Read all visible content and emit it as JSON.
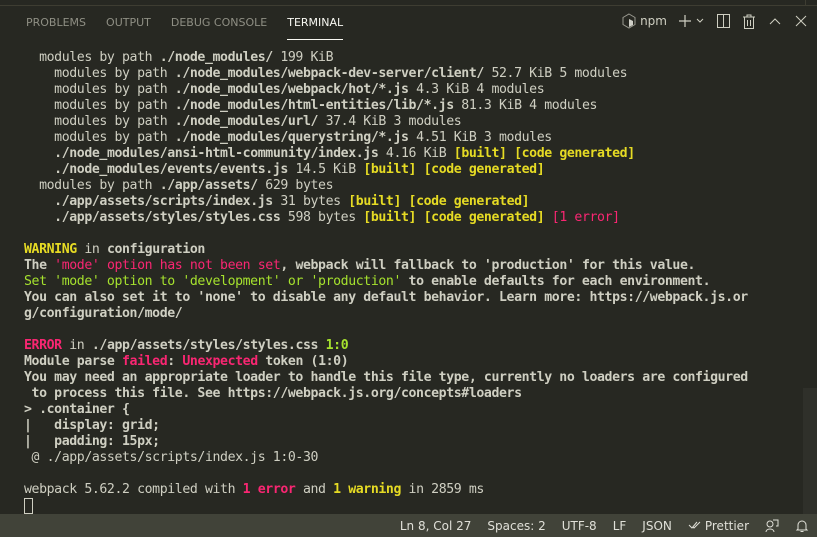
{
  "panel": {
    "tabs": [
      {
        "label": "PROBLEMS",
        "active": false
      },
      {
        "label": "OUTPUT",
        "active": false
      },
      {
        "label": "DEBUG CONSOLE",
        "active": false
      },
      {
        "label": "TERMINAL",
        "active": true
      }
    ],
    "terminal_name": "npm"
  },
  "terminal": {
    "lines": [
      [
        [
          "  modules by path ",
          ""
        ],
        [
          "./node_modules/",
          "b"
        ],
        [
          " 199 KiB",
          ""
        ]
      ],
      [
        [
          "    modules by path ",
          ""
        ],
        [
          "./node_modules/webpack-dev-server/client/",
          "b"
        ],
        [
          " 52.7 KiB 5 modules",
          ""
        ]
      ],
      [
        [
          "    modules by path ",
          ""
        ],
        [
          "./node_modules/webpack/hot/*.js",
          "b"
        ],
        [
          " 4.3 KiB 4 modules",
          ""
        ]
      ],
      [
        [
          "    modules by path ",
          ""
        ],
        [
          "./node_modules/html-entities/lib/*.js",
          "b"
        ],
        [
          " 81.3 KiB 4 modules",
          ""
        ]
      ],
      [
        [
          "    modules by path ",
          ""
        ],
        [
          "./node_modules/url/",
          "b"
        ],
        [
          " 37.4 KiB 3 modules",
          ""
        ]
      ],
      [
        [
          "    modules by path ",
          ""
        ],
        [
          "./node_modules/querystring/*.js",
          "b"
        ],
        [
          " 4.51 KiB 3 modules",
          ""
        ]
      ],
      [
        [
          "    ",
          ""
        ],
        [
          "./node_modules/ansi-html-community/index.js",
          "b"
        ],
        [
          " 4.16 KiB ",
          ""
        ],
        [
          "[built] [code generated]",
          "yellow"
        ]
      ],
      [
        [
          "    ",
          ""
        ],
        [
          "./node_modules/events/events.js",
          "b"
        ],
        [
          " 14.5 KiB ",
          ""
        ],
        [
          "[built] [code generated]",
          "yellow"
        ]
      ],
      [
        [
          "  modules by path ",
          ""
        ],
        [
          "./app/assets/",
          "b"
        ],
        [
          " 629 bytes",
          ""
        ]
      ],
      [
        [
          "    ",
          ""
        ],
        [
          "./app/assets/scripts/index.js",
          "b"
        ],
        [
          " 31 bytes ",
          ""
        ],
        [
          "[built] [code generated]",
          "yellow"
        ]
      ],
      [
        [
          "    ",
          ""
        ],
        [
          "./app/assets/styles/styles.css",
          "b"
        ],
        [
          " 598 bytes ",
          ""
        ],
        [
          "[built] [code generated]",
          "yellow"
        ],
        [
          " ",
          ""
        ],
        [
          "[1 error]",
          "pink"
        ]
      ],
      [],
      [
        [
          "WARNING",
          "yellow"
        ],
        [
          " in ",
          ""
        ],
        [
          "configuration",
          "b"
        ]
      ],
      [
        [
          "The ",
          "b"
        ],
        [
          "'mode' option has not been set",
          "pink"
        ],
        [
          ", webpack will fallback to 'production' for this value.",
          "b"
        ]
      ],
      [
        [
          "Set 'mode' option to 'development' or 'production'",
          "green"
        ],
        [
          " to enable defaults for each environment.",
          "b"
        ]
      ],
      [
        [
          "You can also set it to 'none' to disable any default behavior. Learn more: https://webpack.js.or",
          "b"
        ]
      ],
      [
        [
          "g/configuration/mode/",
          "b"
        ]
      ],
      [],
      [
        [
          "ERROR",
          "pink b"
        ],
        [
          " in ",
          ""
        ],
        [
          "./app/assets/styles/styles.css",
          "b"
        ],
        [
          " ",
          ""
        ],
        [
          "1:0",
          "green b"
        ]
      ],
      [
        [
          "Module parse ",
          "b"
        ],
        [
          "failed",
          "pink b"
        ],
        [
          ": ",
          "b"
        ],
        [
          "Unexpected",
          "pink b"
        ],
        [
          " token (1:0)",
          "b"
        ]
      ],
      [
        [
          "You may need an appropriate loader to handle this file type, currently no loaders are configured",
          "b"
        ]
      ],
      [
        [
          " to process this file. See https://webpack.js.org/concepts#loaders",
          "b"
        ]
      ],
      [
        [
          "> .container {",
          "b"
        ]
      ],
      [
        [
          "|   display: grid;",
          "b"
        ]
      ],
      [
        [
          "|   padding: 15px;",
          "b"
        ]
      ],
      [
        [
          " @ ./app/assets/scripts/index.js 1:0-30",
          ""
        ]
      ],
      [],
      [
        [
          "webpack 5.62.2 compiled with ",
          ""
        ],
        [
          "1 error",
          "pink b"
        ],
        [
          " and ",
          ""
        ],
        [
          "1 warning",
          "yellow"
        ],
        [
          " in 2859 ms",
          ""
        ]
      ]
    ]
  },
  "statusbar": {
    "position": "Ln 8, Col 27",
    "spaces": "Spaces: 2",
    "encoding": "UTF-8",
    "eol": "LF",
    "language": "JSON",
    "formatter": "Prettier"
  }
}
